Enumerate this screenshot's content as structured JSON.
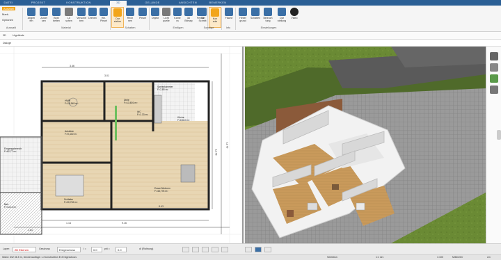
{
  "ribbon_tabs": [
    "DATEI",
    "PROJEKT",
    "KONSTRUKTION",
    "3D",
    "GELÄNDE",
    "ANSICHTEN",
    "BEMERKEN"
  ],
  "quick_tools": [
    "Auswahl",
    "Mark.",
    "Optionen"
  ],
  "ribbon_buttons": [
    {
      "label": "Abgleichen",
      "line1": "Abgrei",
      "line2": "fen"
    },
    {
      "label": "Zuweisen",
      "line1": "Zuwei",
      "line2": "sen"
    },
    {
      "label": "Bearbeiten",
      "line1": "Bear",
      "line2": "beiten"
    },
    {
      "label": "Löschen",
      "line1": "Lö",
      "line2": "schen"
    },
    {
      "label": "Verschieben",
      "line1": "Verschie",
      "line2": "ben"
    },
    {
      "label": "Drehen",
      "line1": "Drehen",
      "line2": ""
    },
    {
      "label": "Hin. Pinsel",
      "line1": "Hin.",
      "line2": "Pinsel"
    },
    {
      "label": "Dar-stellen",
      "line1": "Dar",
      "line2": "stellen"
    },
    {
      "label": "Rechnen",
      "line1": "Rech",
      "line2": "nen"
    },
    {
      "label": "Pinsel",
      "line1": "Pinsel",
      "line2": ""
    },
    {
      "label": "Objekt",
      "line1": "Objekt",
      "line2": ""
    },
    {
      "label": "Licht quelle",
      "line1": "Licht",
      "line2": "quelle"
    },
    {
      "label": "Kamera",
      "line1": "Kame",
      "line2": "ra"
    },
    {
      "label": "3D Bitmap",
      "line1": "3D",
      "line2": "Bitmap"
    },
    {
      "label": "Fenster",
      "line1": "Fenster",
      "line2": ""
    },
    {
      "label": "3D Schnitt",
      "line1": "3D",
      "line2": "Schnitt"
    },
    {
      "label": "Konsole",
      "line1": "Kon",
      "line2": "sole"
    },
    {
      "label": "Fläche",
      "line1": "Fläche",
      "line2": ""
    },
    {
      "label": "Hintergrund",
      "line1": "Hinter",
      "line2": "grund"
    },
    {
      "label": "Schatten",
      "line1": "Schatten",
      "line2": ""
    },
    {
      "label": "Beleuchtung",
      "line1": "Beleuch",
      "line2": "tung"
    },
    {
      "label": "Darstellung",
      "line1": "Dar",
      "line2": "stellung"
    },
    {
      "label": "Video",
      "line1": "Video",
      "line2": ""
    }
  ],
  "ribbon_groups": [
    "Auswahl",
    "Material",
    "Schatten",
    "Einfügen",
    "Sonstige",
    "Info",
    "Einstellungen"
  ],
  "view_toggle": "3D",
  "view_mode": "Urgelände",
  "dialog_label": "Dialoge",
  "rooms": [
    {
      "name": "WC",
      "area": "F=1.33 m²"
    },
    {
      "name": "Diele",
      "area": "F=13,601 m²"
    },
    {
      "name": "HWR",
      "area": "F=15,949 m²"
    },
    {
      "name": "Küche",
      "area": "F=8,610 m²"
    },
    {
      "name": "Ankleide",
      "area": "F=9,430 m²"
    },
    {
      "name": "Eingangsbereich",
      "area": "F=62,77 m²"
    },
    {
      "name": "Schlafen",
      "area": "F=20,702 m²"
    },
    {
      "name": "Essen/Wohnen",
      "area": "F=48,778 m²"
    },
    {
      "name": "Bad",
      "area": "F=14,16 m²"
    },
    {
      "name": "Speisekammer",
      "area": "F=2,85 m²"
    }
  ],
  "dimensions": [
    "11.76",
    "12.76",
    "9.16",
    "1.14",
    "3.46",
    "8.43",
    "1.51",
    "3.01"
  ],
  "status": {
    "layer_label": "Layer:",
    "layer_value": "2D Ebenen",
    "floor_label": "Geschoss",
    "floor_value": "Erdgeschoss",
    "l_label": "l =",
    "l_value": "0.0",
    "phi_label": "phi =",
    "phi_value": "0.0",
    "direction": "dl (Richtung)"
  },
  "footer": {
    "left": "Wand: AW 36.5 m, Deckenauflage: L=Konstruktion E=Erdgeschoss",
    "mode": "Selektion",
    "scale": "1:1 sel.",
    "scale2": "1:100",
    "unit": "Millimeter",
    "zoom": "cm"
  }
}
